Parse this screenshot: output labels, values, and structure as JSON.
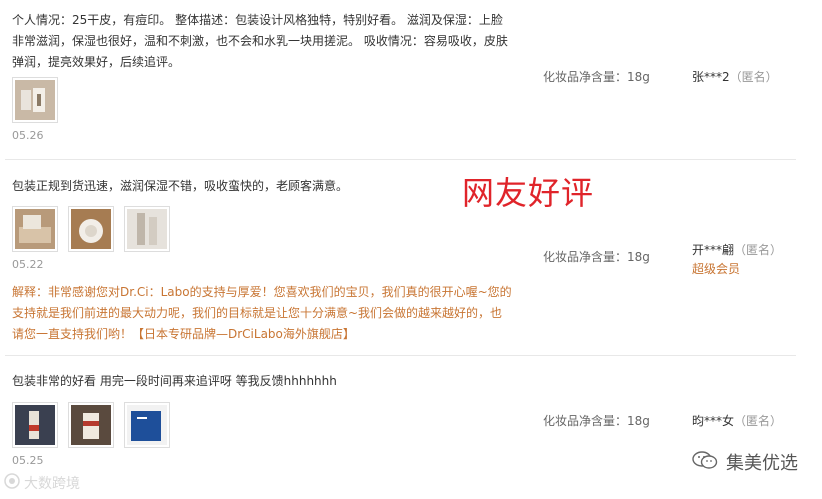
{
  "reviews": [
    {
      "text": "个人情况：25干皮，有痘印。 整体描述：包装设计风格独特，特别好看。 滋润及保湿：上脸非常滋润，保湿也很好，温和不刺激，也不会和水乳一块用搓泥。 吸收情况：容易吸收，皮肤弹润，提亮效果好，后续追评。",
      "date": "05.26",
      "spec": "化妆品净含量：18g",
      "user": "张***2",
      "anon": "（匿名）"
    },
    {
      "text": "包装正规到货迅速，滋润保湿不错，吸收蛮快的，老顾客满意。",
      "date": "05.22",
      "reply": "解释：非常感谢您对Dr.Ci：Labo的支持与厚爱！您喜欢我们的宝贝，我们真的很开心喔~您的支持就是我们前进的最大动力呢，我们的目标就是让您十分满意~我们会做的越来越好的，也请您一直支持我们哟！【日本专研品牌—DrCiLabo海外旗舰店】",
      "spec": "化妆品净含量：18g",
      "user": "开***翩",
      "anon": "（匿名）",
      "badge": "超级会员"
    },
    {
      "text": "包装非常的好看 用完一段时间再来追评呀 等我反馈hhhhhhh",
      "date": "05.25",
      "spec": "化妆品净含量：18g",
      "user": "昀***女",
      "anon": "（匿名）"
    }
  ],
  "overlay_title": "网友好评",
  "watermarks": {
    "bottom_left": "大数跨境",
    "bottom_right": "集美优选"
  },
  "colors": {
    "accent_red": "#e0242a",
    "reply_orange": "#c87533",
    "divider": "#e8e8e8"
  }
}
